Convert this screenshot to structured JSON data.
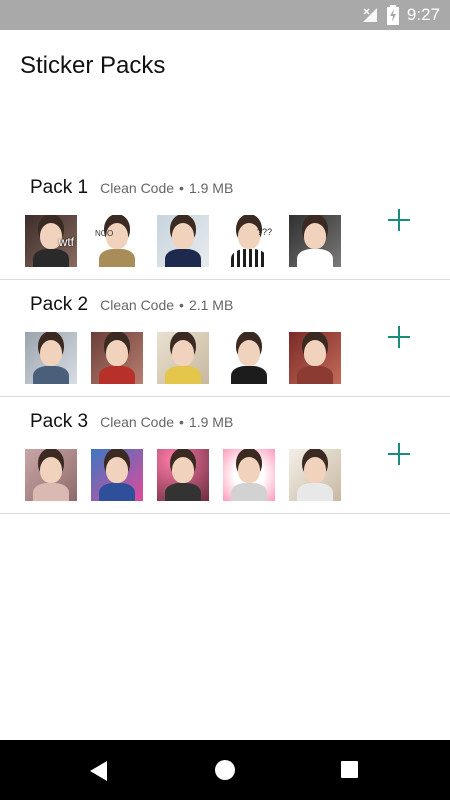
{
  "status_bar": {
    "time": "9:27",
    "icons": [
      "wifi-off-icon",
      "signal-icon",
      "battery-charging-icon"
    ],
    "background": "#a9a9a9"
  },
  "app_bar": {
    "title": "Sticker Packs"
  },
  "packs": [
    {
      "name": "Pack 1",
      "publisher": "Clean Code",
      "size": "1.9 MB",
      "stickers": [
        {
          "caption": "wtf"
        },
        {
          "caption": "NOO"
        },
        {
          "caption": ""
        },
        {
          "caption": "???"
        },
        {
          "caption": ""
        }
      ]
    },
    {
      "name": "Pack 2",
      "publisher": "Clean Code",
      "size": "2.1 MB",
      "stickers": [
        {
          "caption": ""
        },
        {
          "caption": ""
        },
        {
          "caption": ""
        },
        {
          "caption": ""
        },
        {
          "caption": ""
        }
      ]
    },
    {
      "name": "Pack 3",
      "publisher": "Clean Code",
      "size": "1.9 MB",
      "stickers": [
        {
          "caption": ""
        },
        {
          "caption": ""
        },
        {
          "caption": ""
        },
        {
          "caption": ""
        },
        {
          "caption": ""
        }
      ]
    }
  ],
  "separator": "•",
  "add_button_icon": "plus-icon",
  "accent_color": "#1a8c7a",
  "nav_bar": {
    "icons": [
      "back-icon",
      "home-icon",
      "recents-icon"
    ]
  }
}
